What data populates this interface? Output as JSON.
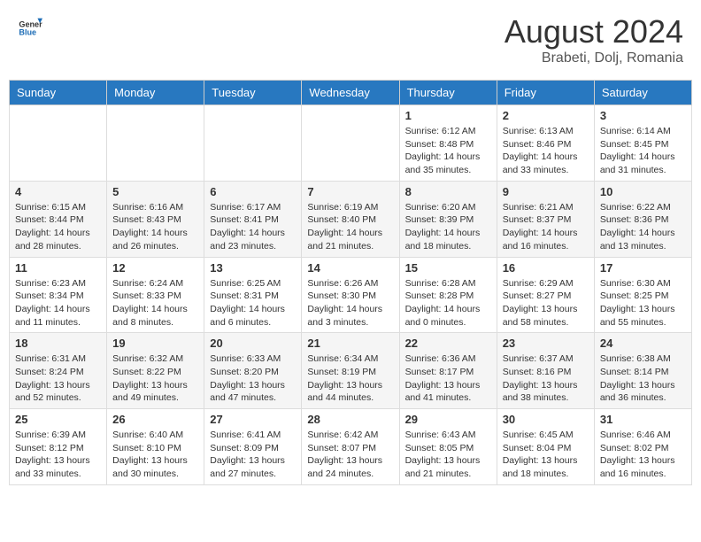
{
  "header": {
    "logo_general": "General",
    "logo_blue": "Blue",
    "month_year": "August 2024",
    "location": "Brabeti, Dolj, Romania"
  },
  "days_of_week": [
    "Sunday",
    "Monday",
    "Tuesday",
    "Wednesday",
    "Thursday",
    "Friday",
    "Saturday"
  ],
  "weeks": [
    [
      {
        "day": "",
        "info": ""
      },
      {
        "day": "",
        "info": ""
      },
      {
        "day": "",
        "info": ""
      },
      {
        "day": "",
        "info": ""
      },
      {
        "day": "1",
        "info": "Sunrise: 6:12 AM\nSunset: 8:48 PM\nDaylight: 14 hours and 35 minutes."
      },
      {
        "day": "2",
        "info": "Sunrise: 6:13 AM\nSunset: 8:46 PM\nDaylight: 14 hours and 33 minutes."
      },
      {
        "day": "3",
        "info": "Sunrise: 6:14 AM\nSunset: 8:45 PM\nDaylight: 14 hours and 31 minutes."
      }
    ],
    [
      {
        "day": "4",
        "info": "Sunrise: 6:15 AM\nSunset: 8:44 PM\nDaylight: 14 hours and 28 minutes."
      },
      {
        "day": "5",
        "info": "Sunrise: 6:16 AM\nSunset: 8:43 PM\nDaylight: 14 hours and 26 minutes."
      },
      {
        "day": "6",
        "info": "Sunrise: 6:17 AM\nSunset: 8:41 PM\nDaylight: 14 hours and 23 minutes."
      },
      {
        "day": "7",
        "info": "Sunrise: 6:19 AM\nSunset: 8:40 PM\nDaylight: 14 hours and 21 minutes."
      },
      {
        "day": "8",
        "info": "Sunrise: 6:20 AM\nSunset: 8:39 PM\nDaylight: 14 hours and 18 minutes."
      },
      {
        "day": "9",
        "info": "Sunrise: 6:21 AM\nSunset: 8:37 PM\nDaylight: 14 hours and 16 minutes."
      },
      {
        "day": "10",
        "info": "Sunrise: 6:22 AM\nSunset: 8:36 PM\nDaylight: 14 hours and 13 minutes."
      }
    ],
    [
      {
        "day": "11",
        "info": "Sunrise: 6:23 AM\nSunset: 8:34 PM\nDaylight: 14 hours and 11 minutes."
      },
      {
        "day": "12",
        "info": "Sunrise: 6:24 AM\nSunset: 8:33 PM\nDaylight: 14 hours and 8 minutes."
      },
      {
        "day": "13",
        "info": "Sunrise: 6:25 AM\nSunset: 8:31 PM\nDaylight: 14 hours and 6 minutes."
      },
      {
        "day": "14",
        "info": "Sunrise: 6:26 AM\nSunset: 8:30 PM\nDaylight: 14 hours and 3 minutes."
      },
      {
        "day": "15",
        "info": "Sunrise: 6:28 AM\nSunset: 8:28 PM\nDaylight: 14 hours and 0 minutes."
      },
      {
        "day": "16",
        "info": "Sunrise: 6:29 AM\nSunset: 8:27 PM\nDaylight: 13 hours and 58 minutes."
      },
      {
        "day": "17",
        "info": "Sunrise: 6:30 AM\nSunset: 8:25 PM\nDaylight: 13 hours and 55 minutes."
      }
    ],
    [
      {
        "day": "18",
        "info": "Sunrise: 6:31 AM\nSunset: 8:24 PM\nDaylight: 13 hours and 52 minutes."
      },
      {
        "day": "19",
        "info": "Sunrise: 6:32 AM\nSunset: 8:22 PM\nDaylight: 13 hours and 49 minutes."
      },
      {
        "day": "20",
        "info": "Sunrise: 6:33 AM\nSunset: 8:20 PM\nDaylight: 13 hours and 47 minutes."
      },
      {
        "day": "21",
        "info": "Sunrise: 6:34 AM\nSunset: 8:19 PM\nDaylight: 13 hours and 44 minutes."
      },
      {
        "day": "22",
        "info": "Sunrise: 6:36 AM\nSunset: 8:17 PM\nDaylight: 13 hours and 41 minutes."
      },
      {
        "day": "23",
        "info": "Sunrise: 6:37 AM\nSunset: 8:16 PM\nDaylight: 13 hours and 38 minutes."
      },
      {
        "day": "24",
        "info": "Sunrise: 6:38 AM\nSunset: 8:14 PM\nDaylight: 13 hours and 36 minutes."
      }
    ],
    [
      {
        "day": "25",
        "info": "Sunrise: 6:39 AM\nSunset: 8:12 PM\nDaylight: 13 hours and 33 minutes."
      },
      {
        "day": "26",
        "info": "Sunrise: 6:40 AM\nSunset: 8:10 PM\nDaylight: 13 hours and 30 minutes."
      },
      {
        "day": "27",
        "info": "Sunrise: 6:41 AM\nSunset: 8:09 PM\nDaylight: 13 hours and 27 minutes."
      },
      {
        "day": "28",
        "info": "Sunrise: 6:42 AM\nSunset: 8:07 PM\nDaylight: 13 hours and 24 minutes."
      },
      {
        "day": "29",
        "info": "Sunrise: 6:43 AM\nSunset: 8:05 PM\nDaylight: 13 hours and 21 minutes."
      },
      {
        "day": "30",
        "info": "Sunrise: 6:45 AM\nSunset: 8:04 PM\nDaylight: 13 hours and 18 minutes."
      },
      {
        "day": "31",
        "info": "Sunrise: 6:46 AM\nSunset: 8:02 PM\nDaylight: 13 hours and 16 minutes."
      }
    ]
  ]
}
